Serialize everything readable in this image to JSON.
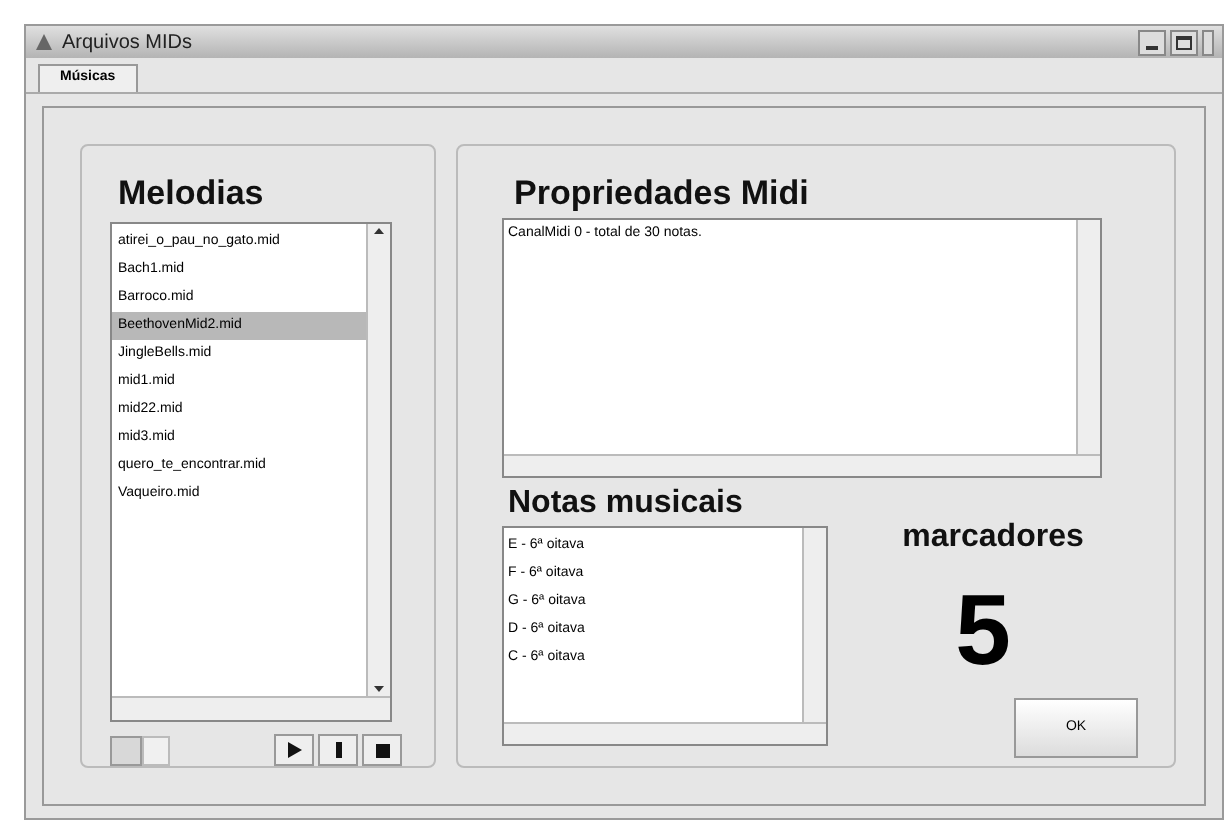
{
  "window": {
    "title": "Arquivos MIDs"
  },
  "tabs": [
    {
      "label": "Músicas",
      "selected": true
    }
  ],
  "melodies": {
    "heading": "Melodias",
    "items": [
      {
        "label": "atirei_o_pau_no_gato.mid",
        "selected": false
      },
      {
        "label": "Bach1.mid",
        "selected": false
      },
      {
        "label": "Barroco.mid",
        "selected": false
      },
      {
        "label": "BeethovenMid2.mid",
        "selected": true
      },
      {
        "label": "JingleBells.mid",
        "selected": false
      },
      {
        "label": "mid1.mid",
        "selected": false
      },
      {
        "label": "mid22.mid",
        "selected": false
      },
      {
        "label": "mid3.mid",
        "selected": false
      },
      {
        "label": "quero_te_encontrar.mid",
        "selected": false
      },
      {
        "label": "Vaqueiro.mid",
        "selected": false
      }
    ]
  },
  "properties": {
    "heading": "Propriedades Midi",
    "text": "CanalMidi 0 - total de 30 notas."
  },
  "notes": {
    "heading": "Notas musicais",
    "items": [
      "E - 6ª oitava",
      "F - 6ª oitava",
      "G - 6ª oitava",
      "D - 6ª oitava",
      "C - 6ª oitava"
    ]
  },
  "markers": {
    "label": "marcadores",
    "value": "5"
  },
  "ok_button": "OK"
}
